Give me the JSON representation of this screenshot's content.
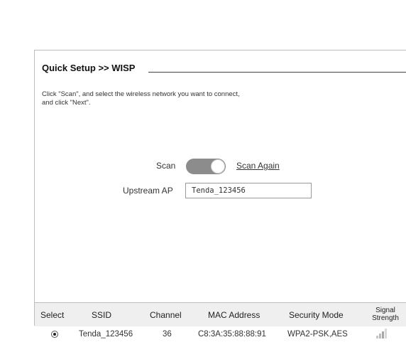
{
  "setup": {
    "title": "Quick Setup >> WISP",
    "description_line1": "Click \"Scan\", and select the wireless network you want to connect,",
    "description_line2": "and click \"Next\"."
  },
  "scan": {
    "label": "Scan",
    "toggle_state": "on",
    "scan_again_label": "Scan Again"
  },
  "upstream": {
    "label": "Upstream AP",
    "value": "Tenda_123456"
  },
  "table": {
    "headers": {
      "select": "Select",
      "ssid": "SSID",
      "channel": "Channel",
      "mac": "MAC Address",
      "security": "Security Mode",
      "signal_line1": "Signal",
      "signal_line2": "Strength"
    },
    "rows": [
      {
        "selected": true,
        "ssid": "Tenda_123456",
        "channel": "36",
        "mac": "C8:3A:35:88:88:91",
        "security": "WPA2-PSK,AES",
        "signal_icon": "signal-bars-icon"
      }
    ]
  }
}
